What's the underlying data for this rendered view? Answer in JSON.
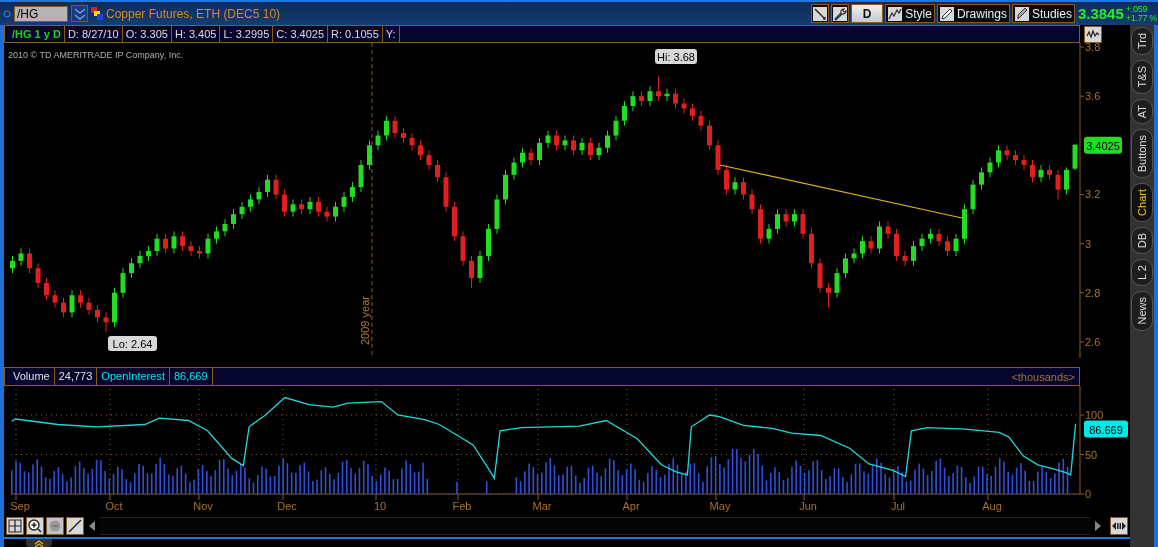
{
  "header": {
    "symbol_field": {
      "value": "/HG"
    },
    "title": "Copper Futures, ETH (DEC5 10)",
    "aggregation": "D",
    "buttons": [
      {
        "label": "Style"
      },
      {
        "label": "Drawings"
      },
      {
        "label": "Studies"
      }
    ],
    "last_price": "3.3845",
    "net_change": "+.059",
    "percent_change": "+1.77 %"
  },
  "info_bar": {
    "study_label": "/HG 1 y D",
    "fields": [
      "D: 8/27/10",
      "O: 3.305",
      "H: 3.405",
      "L: 3.2995",
      "C: 3.4025",
      "R: 0.1055",
      "Y:"
    ]
  },
  "price_chart": {
    "copyright": "2010 © TD AMERITRADE IP Company, Inc.",
    "hi_label": "Hi: 3.68",
    "lo_label": "Lo: 2.64",
    "year_marker": "2009 year",
    "last_price_tag": "3.4025",
    "chart_data": {
      "type": "candlestick",
      "yticks": [
        3.8,
        3.6,
        3.2,
        3,
        2.8,
        2.6
      ],
      "ylim": [
        2.5347,
        3.8163
      ],
      "ohlc": [
        [
          2.9,
          2.95,
          2.88,
          2.93
        ],
        [
          2.93,
          2.98,
          2.91,
          2.96
        ],
        [
          2.96,
          2.98,
          2.88,
          2.9
        ],
        [
          2.9,
          2.92,
          2.82,
          2.84
        ],
        [
          2.84,
          2.86,
          2.77,
          2.79
        ],
        [
          2.79,
          2.81,
          2.74,
          2.76
        ],
        [
          2.76,
          2.78,
          2.7,
          2.72
        ],
        [
          2.72,
          2.81,
          2.7,
          2.79
        ],
        [
          2.79,
          2.81,
          2.74,
          2.76
        ],
        [
          2.76,
          2.78,
          2.71,
          2.73
        ],
        [
          2.73,
          2.75,
          2.68,
          2.7
        ],
        [
          2.7,
          2.72,
          2.64,
          2.68
        ],
        [
          2.68,
          2.82,
          2.66,
          2.8
        ],
        [
          2.8,
          2.9,
          2.78,
          2.88
        ],
        [
          2.88,
          2.94,
          2.86,
          2.92
        ],
        [
          2.92,
          2.97,
          2.9,
          2.95
        ],
        [
          2.95,
          2.99,
          2.93,
          2.97
        ],
        [
          2.97,
          3.04,
          2.95,
          3.02
        ],
        [
          3.02,
          3.04,
          2.96,
          2.98
        ],
        [
          2.98,
          3.05,
          2.96,
          3.03
        ],
        [
          3.03,
          3.05,
          2.97,
          2.99
        ],
        [
          2.99,
          3.01,
          2.95,
          2.97
        ],
        [
          2.97,
          2.99,
          2.94,
          2.96
        ],
        [
          2.96,
          3.04,
          2.94,
          3.02
        ],
        [
          3.02,
          3.07,
          3.0,
          3.05
        ],
        [
          3.05,
          3.1,
          3.03,
          3.08
        ],
        [
          3.08,
          3.14,
          3.06,
          3.12
        ],
        [
          3.12,
          3.17,
          3.1,
          3.15
        ],
        [
          3.15,
          3.2,
          3.13,
          3.18
        ],
        [
          3.18,
          3.23,
          3.16,
          3.21
        ],
        [
          3.21,
          3.28,
          3.19,
          3.26
        ],
        [
          3.26,
          3.28,
          3.18,
          3.2
        ],
        [
          3.2,
          3.22,
          3.11,
          3.13
        ],
        [
          3.13,
          3.18,
          3.11,
          3.16
        ],
        [
          3.16,
          3.18,
          3.12,
          3.14
        ],
        [
          3.14,
          3.19,
          3.12,
          3.17
        ],
        [
          3.17,
          3.19,
          3.11,
          3.13
        ],
        [
          3.13,
          3.15,
          3.09,
          3.11
        ],
        [
          3.11,
          3.17,
          3.09,
          3.15
        ],
        [
          3.15,
          3.21,
          3.13,
          3.19
        ],
        [
          3.19,
          3.25,
          3.17,
          3.23
        ],
        [
          3.23,
          3.34,
          3.21,
          3.32
        ],
        [
          3.32,
          3.42,
          3.3,
          3.4
        ],
        [
          3.4,
          3.46,
          3.38,
          3.44
        ],
        [
          3.44,
          3.52,
          3.42,
          3.5
        ],
        [
          3.5,
          3.52,
          3.43,
          3.45
        ],
        [
          3.45,
          3.47,
          3.41,
          3.43
        ],
        [
          3.43,
          3.45,
          3.38,
          3.4
        ],
        [
          3.4,
          3.42,
          3.34,
          3.36
        ],
        [
          3.36,
          3.38,
          3.3,
          3.32
        ],
        [
          3.32,
          3.34,
          3.25,
          3.27
        ],
        [
          3.27,
          3.29,
          3.13,
          3.15
        ],
        [
          3.15,
          3.17,
          3.01,
          3.03
        ],
        [
          3.03,
          3.05,
          2.91,
          2.93
        ],
        [
          2.93,
          2.95,
          2.82,
          2.86
        ],
        [
          2.86,
          2.97,
          2.84,
          2.95
        ],
        [
          2.95,
          3.08,
          2.93,
          3.06
        ],
        [
          3.06,
          3.2,
          3.04,
          3.18
        ],
        [
          3.18,
          3.3,
          3.16,
          3.28
        ],
        [
          3.28,
          3.35,
          3.26,
          3.33
        ],
        [
          3.33,
          3.39,
          3.31,
          3.37
        ],
        [
          3.37,
          3.39,
          3.32,
          3.34
        ],
        [
          3.34,
          3.43,
          3.32,
          3.41
        ],
        [
          3.41,
          3.46,
          3.39,
          3.44
        ],
        [
          3.44,
          3.46,
          3.38,
          3.4
        ],
        [
          3.4,
          3.44,
          3.38,
          3.42
        ],
        [
          3.42,
          3.44,
          3.36,
          3.38
        ],
        [
          3.38,
          3.43,
          3.36,
          3.41
        ],
        [
          3.41,
          3.43,
          3.34,
          3.36
        ],
        [
          3.36,
          3.41,
          3.34,
          3.39
        ],
        [
          3.39,
          3.46,
          3.37,
          3.44
        ],
        [
          3.44,
          3.52,
          3.42,
          3.5
        ],
        [
          3.5,
          3.58,
          3.48,
          3.56
        ],
        [
          3.56,
          3.62,
          3.54,
          3.6
        ],
        [
          3.6,
          3.62,
          3.56,
          3.58
        ],
        [
          3.58,
          3.64,
          3.56,
          3.62
        ],
        [
          3.62,
          3.68,
          3.58,
          3.6
        ],
        [
          3.6,
          3.63,
          3.58,
          3.61
        ],
        [
          3.61,
          3.63,
          3.55,
          3.57
        ],
        [
          3.57,
          3.59,
          3.53,
          3.55
        ],
        [
          3.55,
          3.57,
          3.5,
          3.52
        ],
        [
          3.52,
          3.54,
          3.46,
          3.48
        ],
        [
          3.48,
          3.5,
          3.38,
          3.4
        ],
        [
          3.4,
          3.42,
          3.28,
          3.3
        ],
        [
          3.3,
          3.32,
          3.2,
          3.22
        ],
        [
          3.22,
          3.27,
          3.2,
          3.25
        ],
        [
          3.25,
          3.27,
          3.18,
          3.2
        ],
        [
          3.2,
          3.22,
          3.12,
          3.14
        ],
        [
          3.14,
          3.16,
          3.0,
          3.02
        ],
        [
          3.02,
          3.08,
          3.0,
          3.06
        ],
        [
          3.06,
          3.14,
          3.04,
          3.12
        ],
        [
          3.12,
          3.14,
          3.07,
          3.09
        ],
        [
          3.09,
          3.14,
          3.07,
          3.12
        ],
        [
          3.12,
          3.14,
          3.02,
          3.04
        ],
        [
          3.04,
          3.06,
          2.9,
          2.92
        ],
        [
          2.92,
          2.94,
          2.8,
          2.82
        ],
        [
          2.82,
          2.84,
          2.74,
          2.8
        ],
        [
          2.8,
          2.9,
          2.78,
          2.88
        ],
        [
          2.88,
          2.96,
          2.86,
          2.94
        ],
        [
          2.94,
          2.98,
          2.92,
          2.96
        ],
        [
          2.96,
          3.03,
          2.94,
          3.01
        ],
        [
          3.01,
          3.03,
          2.96,
          2.98
        ],
        [
          2.98,
          3.09,
          2.96,
          3.07
        ],
        [
          3.07,
          3.09,
          3.02,
          3.04
        ],
        [
          3.04,
          3.06,
          2.93,
          2.95
        ],
        [
          2.95,
          2.97,
          2.91,
          2.93
        ],
        [
          2.93,
          3.01,
          2.91,
          2.99
        ],
        [
          2.99,
          3.04,
          2.97,
          3.02
        ],
        [
          3.02,
          3.06,
          3.0,
          3.04
        ],
        [
          3.04,
          3.06,
          2.99,
          3.01
        ],
        [
          3.01,
          3.03,
          2.95,
          2.97
        ],
        [
          2.97,
          3.04,
          2.95,
          3.02
        ],
        [
          3.02,
          3.16,
          3.0,
          3.14
        ],
        [
          3.14,
          3.26,
          3.12,
          3.24
        ],
        [
          3.24,
          3.31,
          3.22,
          3.29
        ],
        [
          3.29,
          3.35,
          3.27,
          3.33
        ],
        [
          3.33,
          3.4,
          3.31,
          3.38
        ],
        [
          3.38,
          3.4,
          3.34,
          3.36
        ],
        [
          3.36,
          3.38,
          3.32,
          3.34
        ],
        [
          3.34,
          3.36,
          3.3,
          3.32
        ],
        [
          3.32,
          3.34,
          3.25,
          3.27
        ],
        [
          3.27,
          3.32,
          3.25,
          3.3
        ],
        [
          3.3,
          3.32,
          3.26,
          3.28
        ],
        [
          3.28,
          3.3,
          3.18,
          3.22
        ],
        [
          3.22,
          3.31,
          3.2,
          3.3
        ],
        [
          3.305,
          3.405,
          3.2995,
          3.4025
        ]
      ]
    }
  },
  "lower_panel": {
    "legend": [
      {
        "kind": "volume",
        "label": "Volume",
        "value": "24,773"
      },
      {
        "kind": "open_interest",
        "label": "OpenInterest",
        "value": "86,669"
      }
    ],
    "units": "<thousands>",
    "y_axis_labels": [
      "100",
      "50",
      "0"
    ],
    "last_value_tag": "86.669",
    "x_axis_labels": [
      "Sep",
      "Oct",
      "Nov",
      "Dec",
      "10",
      "Feb",
      "Mar",
      "Apr",
      "May",
      "Jun",
      "Jul",
      "Aug"
    ]
  },
  "side_tabs": [
    {
      "label": "Trd",
      "selected": false
    },
    {
      "label": "T&S",
      "selected": false
    },
    {
      "label": "AT",
      "selected": false
    },
    {
      "label": "Buttons",
      "selected": false
    },
    {
      "label": "Chart",
      "selected": true
    },
    {
      "label": "DB",
      "selected": false
    },
    {
      "label": "L 2",
      "selected": false
    },
    {
      "label": "News",
      "selected": false
    }
  ]
}
